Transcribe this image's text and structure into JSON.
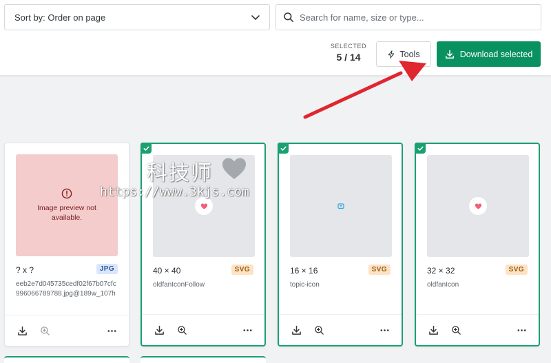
{
  "toolbar": {
    "sort_label": "Sort by: Order on page",
    "search_placeholder": "Search for name, size or type...",
    "selected_caption": "SELECTED",
    "selected_count": "5 / 14",
    "tools_label": "Tools",
    "download_label": "Download selected"
  },
  "colors": {
    "accent": "#0a9160",
    "selected_border": "#1aa071",
    "annotation_arrow": "#e0262e",
    "error_preview": "#f4cccc"
  },
  "cards": [
    {
      "selected": false,
      "preview_error": "Image preview not available.",
      "dims": "? x ?",
      "type": "JPG",
      "filename": "eeb2e7d045735cedf02f67b07cfc996066789788.jpg@189w_107h"
    },
    {
      "selected": true,
      "icon": "heart-icon",
      "dims": "40 × 40",
      "type": "SVG",
      "filename": "oldfanIconFollow"
    },
    {
      "selected": true,
      "icon": "topic-icon",
      "dims": "16 × 16",
      "type": "SVG",
      "filename": "topic-icon"
    },
    {
      "selected": true,
      "icon": "heart-icon",
      "dims": "32 × 32",
      "type": "SVG",
      "filename": "oldfanIcon"
    }
  ],
  "watermark": {
    "text_cn": "科技师",
    "url": "https://www.3kjs.com"
  }
}
